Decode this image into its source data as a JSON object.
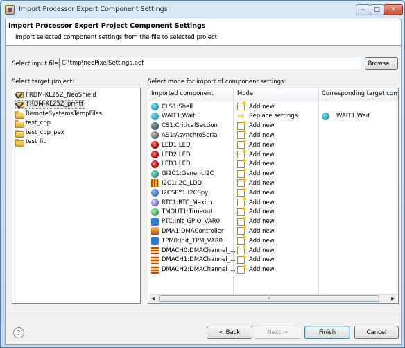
{
  "window": {
    "title": "Import Processor Expert Component Settings"
  },
  "banner": {
    "title": "Import Processor Expert Project Component Settings",
    "subtitle": "Import selected component settings from the file to selected project."
  },
  "input_file": {
    "label": "Select input file:",
    "value": "C:\\tmp\\neoPixelSettings.pef",
    "browse_label": "Browse..."
  },
  "target_project": {
    "label": "Select target project:",
    "items": [
      {
        "name": "FRDM-KL25Z_NeoShield",
        "icon": "project-icon"
      },
      {
        "name": "FRDM-KL25Z_printf",
        "icon": "project-icon",
        "selected": true
      },
      {
        "name": "RemoteSystemsTempFiles",
        "icon": "folder-icon"
      },
      {
        "name": "test_cpp",
        "icon": "folder-icon"
      },
      {
        "name": "test_cpp_pex",
        "icon": "folder-icon"
      },
      {
        "name": "test_lib",
        "icon": "folder-icon"
      }
    ]
  },
  "mode_table": {
    "label": "Select mode for import of component settings:",
    "headers": [
      "Imported component",
      "Mode",
      "Corresponding target compo"
    ],
    "rows": [
      {
        "component": "CLS1:Shell",
        "icon": "shell",
        "mode": "Add new",
        "mode_icon": "add",
        "target": ""
      },
      {
        "component": "WAIT1:Wait",
        "icon": "wait",
        "mode": "Replace settings",
        "mode_icon": "replace",
        "target": "WAIT1:Wait"
      },
      {
        "component": "CS1:CriticalSection",
        "icon": "crit",
        "mode": "Add new",
        "mode_icon": "add",
        "target": ""
      },
      {
        "component": "AS1:AsynchroSerial",
        "icon": "serial",
        "mode": "Add new",
        "mode_icon": "add",
        "target": ""
      },
      {
        "component": "LED1:LED",
        "icon": "led",
        "mode": "Add new",
        "mode_icon": "add",
        "target": ""
      },
      {
        "component": "LED2:LED",
        "icon": "led",
        "mode": "Add new",
        "mode_icon": "add",
        "target": ""
      },
      {
        "component": "LED3:LED",
        "icon": "led",
        "mode": "Add new",
        "mode_icon": "add",
        "target": ""
      },
      {
        "component": "GI2C1:GenericI2C",
        "icon": "i2c",
        "mode": "Add new",
        "mode_icon": "add",
        "target": ""
      },
      {
        "component": "I2C1:I2C_LDD",
        "icon": "ldd",
        "mode": "Add new",
        "mode_icon": "add",
        "target": ""
      },
      {
        "component": "I2CSPY1:I2CSpy",
        "icon": "spy",
        "mode": "Add new",
        "mode_icon": "add",
        "target": ""
      },
      {
        "component": "RTC1:RTC_Maxim",
        "icon": "rtc",
        "mode": "Add new",
        "mode_icon": "add",
        "target": ""
      },
      {
        "component": "TMOUT1:Timeout",
        "icon": "tmout",
        "mode": "Add new",
        "mode_icon": "add",
        "target": ""
      },
      {
        "component": "PTC:Init_GPIO_VAR0",
        "icon": "gpio",
        "mode": "Add new",
        "mode_icon": "add",
        "target": ""
      },
      {
        "component": "DMA1:DMAController",
        "icon": "dma",
        "mode": "Add new",
        "mode_icon": "add",
        "target": ""
      },
      {
        "component": "TPM0:Init_TPM_VAR0",
        "icon": "tpm",
        "mode": "Add new",
        "mode_icon": "add",
        "target": ""
      },
      {
        "component": "DMACH0:DMAChannel_...",
        "icon": "dmach",
        "mode": "Add new",
        "mode_icon": "add",
        "target": ""
      },
      {
        "component": "DMACH1:DMAChannel_...",
        "icon": "dmach",
        "mode": "Add new",
        "mode_icon": "add",
        "target": ""
      },
      {
        "component": "DMACH2:DMAChannel_...",
        "icon": "dmach",
        "mode": "Add new",
        "mode_icon": "add",
        "target": ""
      }
    ],
    "scroll_grip": "III"
  },
  "footer": {
    "help": "?",
    "back": "< Back",
    "next": "Next >",
    "finish": "Finish",
    "cancel": "Cancel"
  },
  "window_controls": {
    "minimize": "–",
    "maximize": "□",
    "close": "✕"
  }
}
